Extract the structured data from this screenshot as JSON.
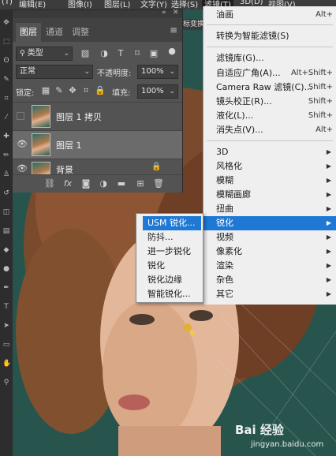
{
  "menubar": {
    "items": [
      "(T)",
      "编辑(E)",
      "图像(I)",
      "图层(L)",
      "文字(Y)",
      "选择(S)",
      "滤镜(T)",
      "3D(D)",
      "视图(V)"
    ],
    "active": "滤镜(T)"
  },
  "layers_panel": {
    "tabs": [
      "图层",
      "通道",
      "调整"
    ],
    "active_tab": "图层",
    "filter_kind": "类型",
    "blend_mode": "正常",
    "opacity_label": "不透明度:",
    "opacity_value": "100%",
    "lock_label": "锁定:",
    "fill_label": "填充:",
    "fill_value": "100%",
    "layers": [
      {
        "name": "图层 1 拷贝",
        "visible": false,
        "selected": false,
        "locked": false
      },
      {
        "name": "图层 1",
        "visible": true,
        "selected": true,
        "locked": false
      },
      {
        "name": "背景",
        "visible": true,
        "selected": false,
        "locked": true
      }
    ],
    "bottom_fx": "fx",
    "canvas_tab_text": "标变换"
  },
  "filter_menu": {
    "items": [
      {
        "label": "油画",
        "shortcut": "Alt+"
      },
      {
        "label": "转换为智能滤镜(S)",
        "shortcut": ""
      },
      {
        "label": "滤镜库(G)...",
        "shortcut": ""
      },
      {
        "label": "自适应广角(A)...",
        "shortcut": "Alt+Shift+"
      },
      {
        "label": "Camera Raw 滤镜(C)...",
        "shortcut": "Shift+"
      },
      {
        "label": "镜头校正(R)...",
        "shortcut": "Shift+"
      },
      {
        "label": "液化(L)...",
        "shortcut": "Shift+"
      },
      {
        "label": "消失点(V)...",
        "shortcut": "Alt+"
      },
      {
        "label": "3D",
        "submenu": true
      },
      {
        "label": "风格化",
        "submenu": true
      },
      {
        "label": "模糊",
        "submenu": true
      },
      {
        "label": "模糊画廊",
        "submenu": true
      },
      {
        "label": "扭曲",
        "submenu": true
      },
      {
        "label": "锐化",
        "submenu": true,
        "highlighted": true
      },
      {
        "label": "视频",
        "submenu": true
      },
      {
        "label": "像素化",
        "submenu": true
      },
      {
        "label": "渲染",
        "submenu": true
      },
      {
        "label": "杂色",
        "submenu": true
      },
      {
        "label": "其它",
        "submenu": true
      }
    ]
  },
  "sharpen_submenu": {
    "items": [
      "USM 锐化...",
      "防抖...",
      "进一步锐化",
      "锐化",
      "锐化边缘",
      "智能锐化..."
    ],
    "hovered": "USM 锐化..."
  },
  "watermark": {
    "text": "Bai 经验",
    "url": "jingyan.baidu.com"
  },
  "colors": {
    "panel_bg": "#535353",
    "menu_bg": "#efefef",
    "highlight": "#1f78d4",
    "photo_bg": "#2d5e56"
  }
}
